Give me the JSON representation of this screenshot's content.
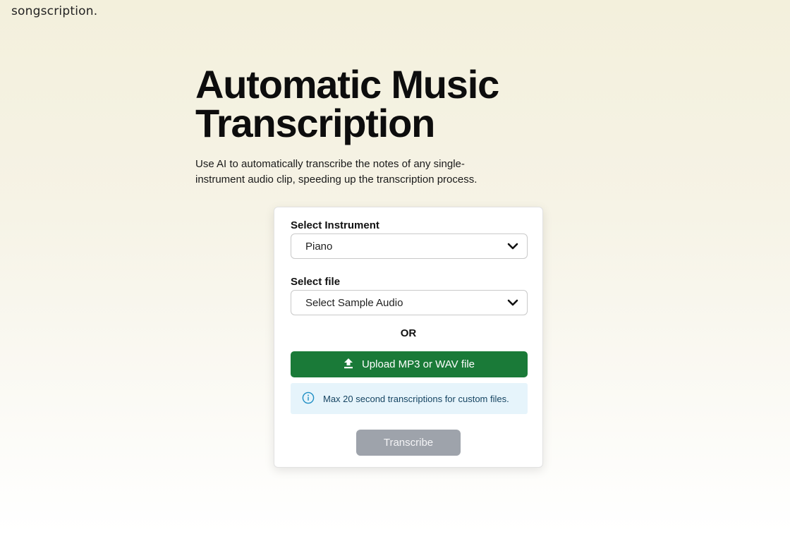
{
  "brand": {
    "logo_text": "songscription."
  },
  "hero": {
    "title_line1": "Automatic Music",
    "title_line2": "Transcription",
    "description": "Use AI to automatically transcribe the notes of any single-instrument audio clip, speeding up the transcription process."
  },
  "form": {
    "instrument_label": "Select Instrument",
    "instrument_value": "Piano",
    "file_label": "Select file",
    "file_value": "Select Sample Audio",
    "or_text": "OR",
    "upload_label": "Upload MP3 or WAV file",
    "info_text": "Max 20 second transcriptions for custom files.",
    "transcribe_label": "Transcribe"
  },
  "colors": {
    "upload_button": "#1a7a38",
    "info_background": "#e6f4fb",
    "transcribe_disabled": "#9ea3ab",
    "info_icon": "#1f8fc4"
  },
  "icons": {
    "select_chevron": "chevron-down-icon",
    "upload": "upload-icon",
    "info": "info-icon"
  }
}
